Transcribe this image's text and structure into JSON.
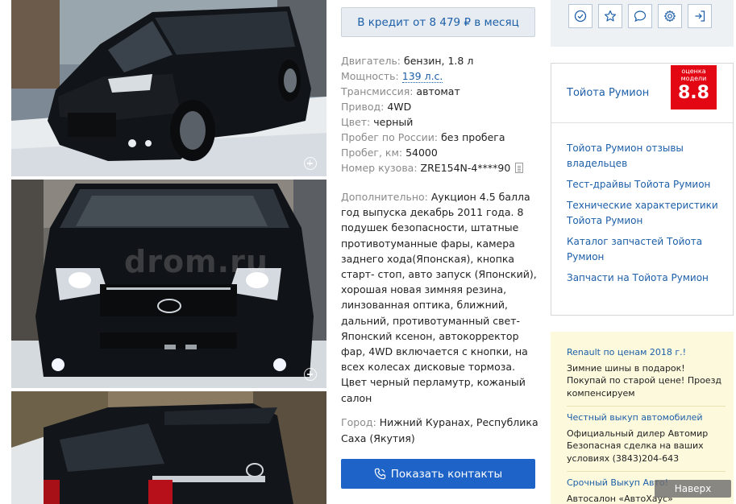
{
  "credit": {
    "label": "В кредит от 8 479 ₽ в месяц"
  },
  "specs": [
    {
      "label": "Двигатель:",
      "value": "бензин, 1.8 л"
    },
    {
      "label": "Мощность:",
      "value": "139 л.с."
    },
    {
      "label": "Трансмиссия:",
      "value": "автомат"
    },
    {
      "label": "Привод:",
      "value": "4WD"
    },
    {
      "label": "Цвет:",
      "value": "черный"
    },
    {
      "label": "Пробег по России:",
      "value": "без пробега"
    },
    {
      "label": "Пробег, км:",
      "value": "54000"
    },
    {
      "label": "Номер кузова:",
      "value": "ZRE154N-4****90"
    }
  ],
  "description": {
    "label": "Дополнительно:",
    "text": "Аукцион 4.5 балла год выпуска декабрь 2011 года. 8 подушек безопасности, штатные противотуманные фары, камера заднего хода(Японская), кнопка старт- стоп, авто запуск (Японский), хорошая новая зимняя резина, линзованная оптика, ближний, дальний, противотуманный свет- Японский ксенон, автокорректор фар, 4WD включается с кнопки, на всех колесах дисковые тормоза. Цвет черный перламутр, кожаный салон"
  },
  "city": {
    "label": "Город:",
    "value": "Нижний Куранах, Республика Саха (Якутия)"
  },
  "contacts_button": "Показать контакты",
  "photos": {
    "watermark": "drom.ru"
  },
  "model": {
    "title": "Тойота Румион",
    "rating_caption": "оценка модели",
    "rating_value": "8.8",
    "links": [
      "Тойота Румион отзывы владельцев",
      "Тест-драйвы Тойота Румион",
      "Технические характеристики Тойота Румион",
      "Каталог запчастей Тойота Румион",
      "Запчасти на Тойота Румион"
    ]
  },
  "ads": [
    {
      "title": "Renault по ценам 2018 г.!",
      "body": "Зимние шины в подарок! Покупай по старой цене! Проезд компенсируем"
    },
    {
      "title": "Честный выкуп автомобилей",
      "body": "Официальный дилер Автомир Безопасная сделка на ваших условиях (3843)204-643"
    },
    {
      "title": "Срочный Выкуп Авто!",
      "body": "Автосалон «АвтоХаус»"
    }
  ],
  "back_to_top": "Наверх",
  "icons": [
    "check-circle-icon",
    "star-icon",
    "chat-icon",
    "gear-icon",
    "logout-icon",
    "zoom-icon",
    "phone-icon",
    "document-icon"
  ],
  "colors": {
    "link": "#1d5fa8",
    "primary_button": "#1e64c8",
    "rating_badge": "#e30613",
    "ads_background": "#fdf9dd"
  }
}
